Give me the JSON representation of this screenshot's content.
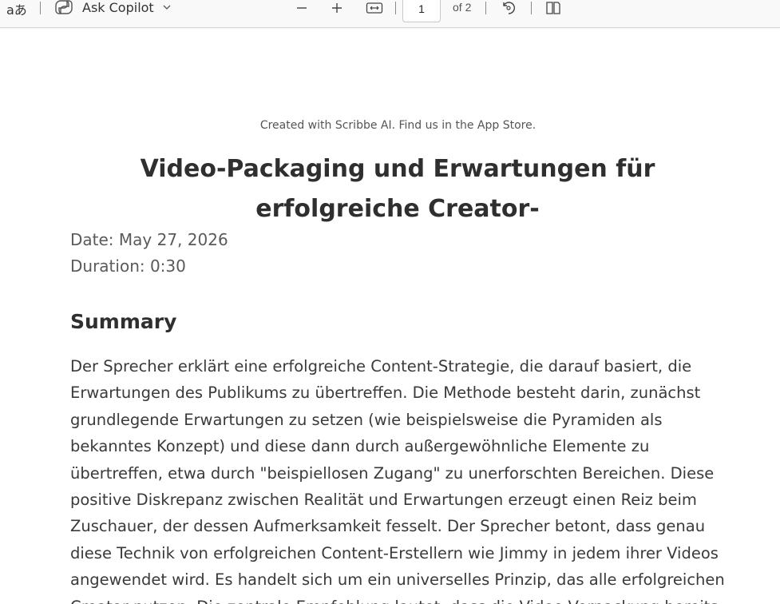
{
  "toolbar": {
    "translate_icon_glyph": "aあ",
    "copilot_label": "Ask Copilot",
    "page_current": "1",
    "page_total_label": "of 2"
  },
  "document": {
    "credit": "Created with Scribbe AI. Find us in the App Store.",
    "title": "Video-Packaging und Erwartungen für erfolgreiche Creator-",
    "date": "Date: May 27, 2026",
    "duration": "Duration: 0:30",
    "summary_heading": "Summary",
    "summary_text": "Der Sprecher erklärt eine erfolgreiche Content-Strategie, die darauf basiert, die Erwartungen des Publikums zu übertreffen. Die Methode besteht darin, zunächst grundlegende Erwartungen zu setzen (wie beispielsweise die Pyramiden als bekanntes Konzept) und diese dann durch außergewöhnliche Elemente zu übertreffen, etwa durch \"beispiellosen Zugang\" zu unerforschten Bereichen. Diese positive Diskrepanz zwischen Realität und Erwartungen erzeugt einen Reiz beim Zuschauer, der dessen Aufmerksamkeit fesselt. Der Sprecher betont, dass genau diese Technik von erfolgreichen Content-Erstellern wie Jimmy in jedem ihrer Videos angewendet wird. Es handelt sich um ein universelles Prinzip, das alle erfolgreichen Creator nutzen. Die zentrale Empfehlung lautet, dass die Video-Verpackung bereits"
  },
  "colors": {
    "toolbar_bg": "#f9f9f9",
    "text_primary": "#2f2f2f",
    "text_secondary": "#5a5a5a"
  },
  "icons": [
    "translate-icon",
    "copilot-icon",
    "chevron-down-icon",
    "zoom-out-icon",
    "zoom-in-icon",
    "fit-width-icon",
    "rotate-icon",
    "page-view-icon"
  ]
}
